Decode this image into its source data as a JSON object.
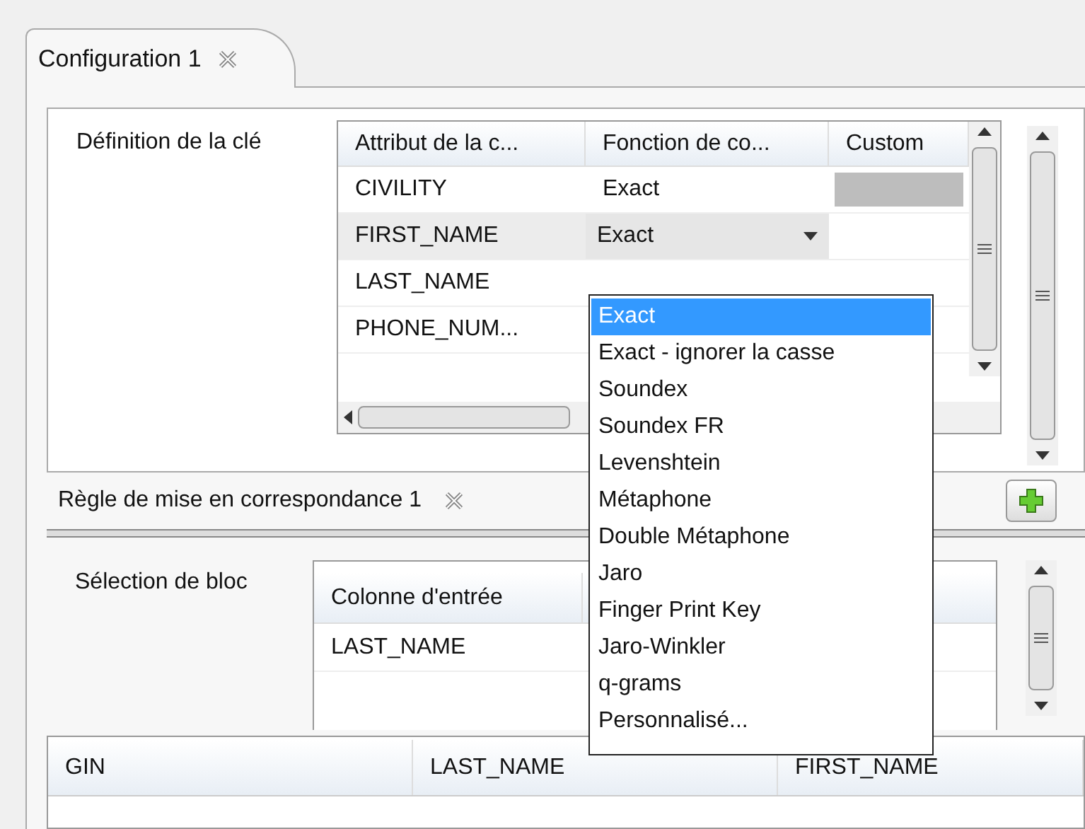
{
  "tab": {
    "label": "Configuration 1"
  },
  "key_definition": {
    "label": "Définition de la clé",
    "columns": [
      "Attribut de la c...",
      "Fonction de co...",
      "Custom"
    ],
    "rows": [
      {
        "attribute": "CIVILITY",
        "function": "Exact",
        "kind": "text"
      },
      {
        "attribute": "FIRST_NAME",
        "function": "Exact",
        "kind": "combo"
      },
      {
        "attribute": "LAST_NAME",
        "kind": "hidden"
      },
      {
        "attribute": "PHONE_NUM...",
        "kind": "hidden"
      }
    ]
  },
  "rule_tab": {
    "label": "Règle de mise en correspondance 1"
  },
  "block_selection": {
    "label": "Sélection de bloc",
    "columns": [
      "Colonne d'entrée"
    ],
    "rows": [
      "LAST_NAME"
    ]
  },
  "results_table": {
    "columns": [
      "GIN",
      "LAST_NAME",
      "FIRST_NAME"
    ]
  },
  "dropdown": {
    "options": [
      {
        "label": "Exact",
        "selected": true
      },
      {
        "label": "Exact - ignorer la casse",
        "selected": false
      },
      {
        "label": "Soundex",
        "selected": false
      },
      {
        "label": "Soundex FR",
        "selected": false
      },
      {
        "label": "Levenshtein",
        "selected": false
      },
      {
        "label": "Métaphone",
        "selected": false
      },
      {
        "label": "Double Métaphone",
        "selected": false
      },
      {
        "label": "Jaro",
        "selected": false
      },
      {
        "label": "Finger Print Key",
        "selected": false
      },
      {
        "label": "Jaro-Winkler",
        "selected": false
      },
      {
        "label": "q-grams",
        "selected": false
      },
      {
        "label": "Personnalisé...",
        "selected": false
      }
    ]
  }
}
